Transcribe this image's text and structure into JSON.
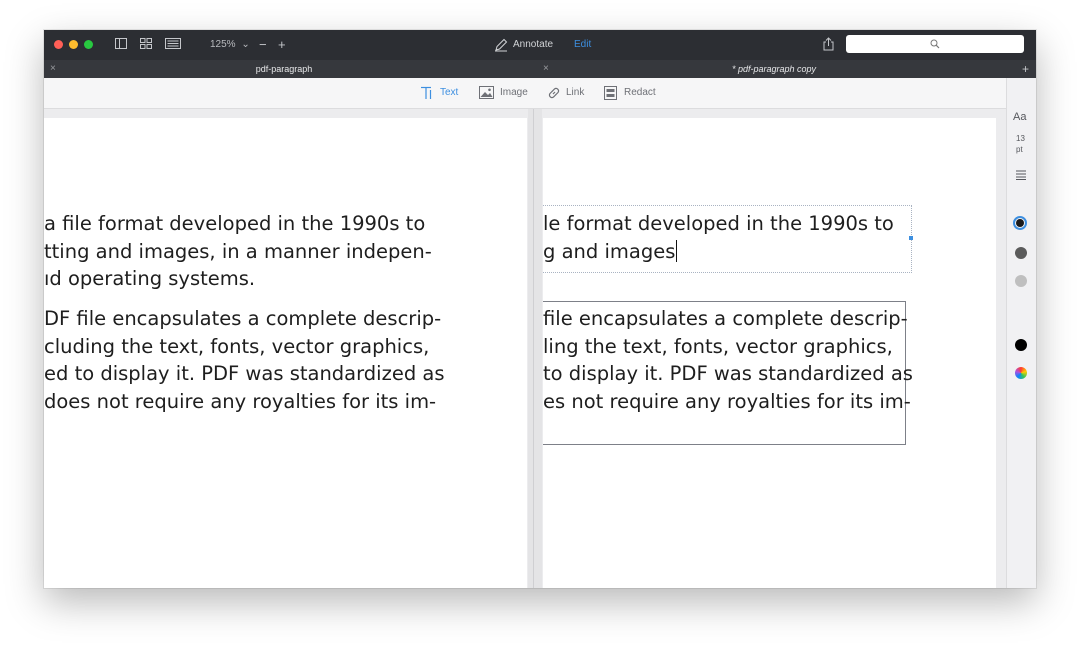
{
  "titlebar": {
    "zoom_label": "125%",
    "zoom_chevron": "⌄",
    "zoom_out": "−",
    "zoom_in": "+",
    "annotate_label": "Annotate",
    "edit_label": "Edit",
    "traffic_lights": [
      "#ff5f57",
      "#febc2e",
      "#28c840"
    ],
    "search_icon": "search-icon",
    "share_icon": "share-icon"
  },
  "tabs": [
    {
      "label": "pdf-paragraph",
      "close": "×",
      "modified": false
    },
    {
      "label": "* pdf-paragraph copy",
      "close": "×",
      "modified": true
    }
  ],
  "new_tab": "+",
  "toolbar": {
    "tools": [
      {
        "id": "text",
        "label": "Text",
        "icon": "text-tool-icon",
        "active": true
      },
      {
        "id": "image",
        "label": "Image",
        "icon": "image-tool-icon",
        "active": false
      },
      {
        "id": "link",
        "label": "Link",
        "icon": "link-tool-icon",
        "active": false
      },
      {
        "id": "redact",
        "label": "Redact",
        "icon": "redact-tool-icon",
        "active": false
      }
    ]
  },
  "left_page": {
    "para1": [
      "a file format developed in the 1990s to",
      "tting and images, in a manner indepen-",
      "ıd operating systems."
    ],
    "para2": [
      "DF file encapsulates a complete descrip-",
      "cluding the text, fonts, vector graphics,",
      "ed to display it. PDF was standardized as",
      " does not require any royalties for its im-"
    ]
  },
  "right_page": {
    "para1": [
      "le format developed in the 1990s to",
      "g and images"
    ],
    "para2": [
      "file encapsulates a complete descrip-",
      "ling the text, fonts, vector graphics,",
      "to display it. PDF was standardized as",
      "es not require any royalties for its im-"
    ]
  },
  "inspector": {
    "font_label": "Aa",
    "size_value": "13",
    "size_unit": "pt",
    "align_icon": "align-justify-icon",
    "colors": [
      "#1a1a1a",
      "#5b5b5b",
      "#bfbfbf",
      "#000000"
    ],
    "color_picker_icon": "color-wheel-icon"
  },
  "colors": {
    "accent": "#3d8fe0",
    "titlebar": "#2c2e33",
    "tabbar": "#36383d"
  }
}
